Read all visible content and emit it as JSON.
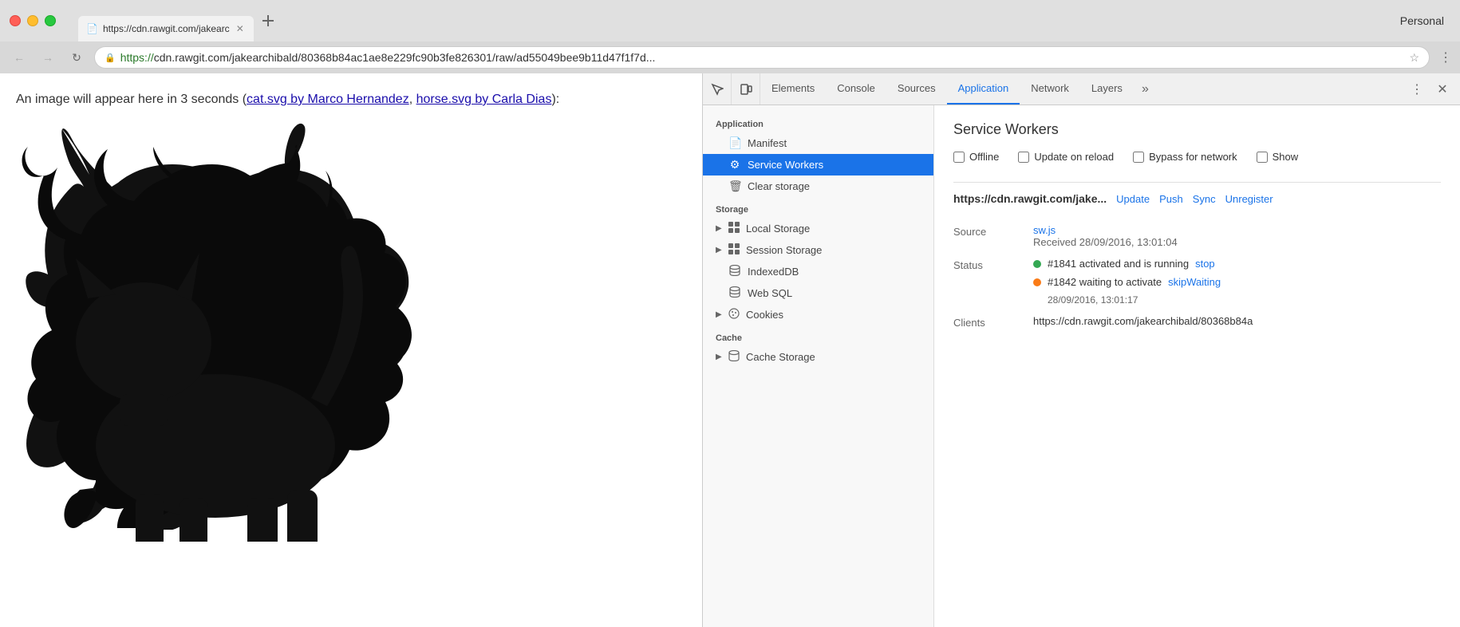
{
  "browser": {
    "profile": "Personal",
    "tab": {
      "title": "https://cdn.rawgit.com/jakearc",
      "url_full": "https://cdn.rawgit.com/jakearchibald/80368b84ac1ae8e229fc90b3fe826301/raw/ad55049bee9b11d47f1f7d...",
      "url_https": "https://",
      "url_rest": "cdn.rawgit.com/jakearchibald/80368b84ac1ae8e229fc90b3fe826301/raw/ad55049bee9b11d47f1f7d..."
    }
  },
  "page": {
    "text": "An image will appear here in 3 seconds (",
    "link1": "cat.svg by Marco Hernandez",
    "separator": ", ",
    "link2": "horse.svg by Carla Dias",
    "text_end": "):"
  },
  "devtools": {
    "tabs": [
      {
        "id": "elements",
        "label": "Elements"
      },
      {
        "id": "console",
        "label": "Console"
      },
      {
        "id": "sources",
        "label": "Sources"
      },
      {
        "id": "application",
        "label": "Application"
      },
      {
        "id": "network",
        "label": "Network"
      },
      {
        "id": "layers",
        "label": "Layers"
      }
    ],
    "active_tab": "application",
    "sidebar": {
      "sections": [
        {
          "label": "Application",
          "items": [
            {
              "id": "manifest",
              "label": "Manifest",
              "icon": "📄",
              "active": false,
              "expandable": false
            },
            {
              "id": "service-workers",
              "label": "Service Workers",
              "icon": "⚙",
              "active": true,
              "expandable": false
            },
            {
              "id": "clear-storage",
              "label": "Clear storage",
              "icon": "🗑",
              "active": false,
              "expandable": false
            }
          ]
        },
        {
          "label": "Storage",
          "items": [
            {
              "id": "local-storage",
              "label": "Local Storage",
              "icon": "grid",
              "active": false,
              "expandable": true
            },
            {
              "id": "session-storage",
              "label": "Session Storage",
              "icon": "grid",
              "active": false,
              "expandable": true
            },
            {
              "id": "indexeddb",
              "label": "IndexedDB",
              "icon": "db",
              "active": false,
              "expandable": false
            },
            {
              "id": "web-sql",
              "label": "Web SQL",
              "icon": "db",
              "active": false,
              "expandable": false
            },
            {
              "id": "cookies",
              "label": "Cookies",
              "icon": "cookie",
              "active": false,
              "expandable": true
            }
          ]
        },
        {
          "label": "Cache",
          "items": [
            {
              "id": "cache-storage",
              "label": "Cache Storage",
              "icon": "db",
              "active": false,
              "expandable": true
            }
          ]
        }
      ]
    },
    "service_workers": {
      "title": "Service Workers",
      "options": [
        {
          "id": "offline",
          "label": "Offline",
          "checked": false
        },
        {
          "id": "update-on-reload",
          "label": "Update on reload",
          "checked": false
        },
        {
          "id": "bypass-for-network",
          "label": "Bypass for network",
          "checked": false
        },
        {
          "id": "show",
          "label": "Show",
          "checked": false
        }
      ],
      "entry": {
        "url": "https://cdn.rawgit.com/jake...",
        "actions": [
          "Update",
          "Push",
          "Sync",
          "Unregister"
        ],
        "source_label": "Source",
        "source_link": "sw.js",
        "received": "Received 28/09/2016, 13:01:04",
        "status_label": "Status",
        "status1_dot": "green",
        "status1_text": "#1841 activated and is running",
        "status1_action": "stop",
        "status2_dot": "orange",
        "status2_text": "#1842 waiting to activate",
        "status2_action": "skipWaiting",
        "status2_date": "28/09/2016, 13:01:17",
        "clients_label": "Clients",
        "clients_value": "https://cdn.rawgit.com/jakearchibald/80368b84a"
      }
    }
  }
}
